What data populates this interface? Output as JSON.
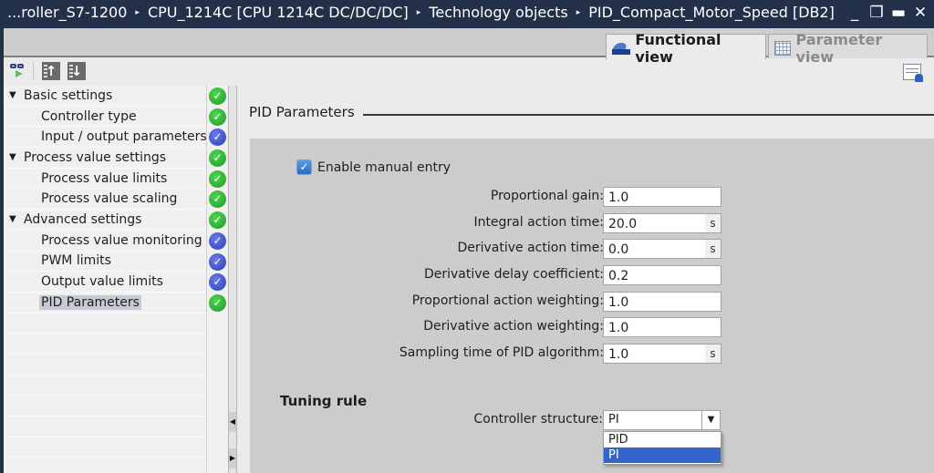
{
  "titlebar": {
    "breadcrumb": [
      "...roller_S7-1200",
      "CPU_1214C [CPU 1214C DC/DC/DC]",
      "Technology objects",
      "PID_Compact_Motor_Speed [DB2]"
    ],
    "separator": "▸",
    "controls": {
      "minimize": "_",
      "restore": "❐",
      "maximize": "▬",
      "close": "✕"
    }
  },
  "tabs": {
    "functional_view": "Functional view",
    "parameter_view": "Parameter view",
    "active": "Functional view"
  },
  "nav": {
    "items": [
      {
        "label": "Basic settings",
        "level": 0,
        "expanded": true,
        "status": "ok"
      },
      {
        "label": "Controller type",
        "level": 1,
        "status": "ok"
      },
      {
        "label": "Input / output parameters",
        "level": 1,
        "status": "info"
      },
      {
        "label": "Process value settings",
        "level": 0,
        "expanded": true,
        "status": "ok"
      },
      {
        "label": "Process value limits",
        "level": 1,
        "status": "ok"
      },
      {
        "label": "Process value scaling",
        "level": 1,
        "status": "ok"
      },
      {
        "label": "Advanced settings",
        "level": 0,
        "expanded": true,
        "status": "ok"
      },
      {
        "label": "Process value monitoring",
        "level": 1,
        "status": "info"
      },
      {
        "label": "PWM limits",
        "level": 1,
        "status": "info"
      },
      {
        "label": "Output value limits",
        "level": 1,
        "status": "info"
      },
      {
        "label": "PID Parameters",
        "level": 1,
        "status": "ok",
        "selected": true
      }
    ],
    "caret": "▼",
    "check": "✓"
  },
  "splitter": {
    "left_arrow": "◀",
    "right_arrow": "▶"
  },
  "content": {
    "section_title": "PID Parameters",
    "enable_manual_entry": {
      "label": "Enable manual entry",
      "checked": true,
      "check": "✓"
    },
    "fields": [
      {
        "label": "Proportional gain:",
        "value": "1.0",
        "unit": ""
      },
      {
        "label": "Integral action time:",
        "value": "20.0",
        "unit": "s"
      },
      {
        "label": "Derivative action time:",
        "value": "0.0",
        "unit": "s"
      },
      {
        "label": "Derivative delay coefficient:",
        "value": "0.2",
        "unit": ""
      },
      {
        "label": "Proportional action weighting:",
        "value": "1.0",
        "unit": ""
      },
      {
        "label": "Derivative action weighting:",
        "value": "1.0",
        "unit": ""
      },
      {
        "label": "Sampling time of PID algorithm:",
        "value": "1.0",
        "unit": "s"
      }
    ],
    "tuning_rule": {
      "title": "Tuning rule",
      "controller_structure_label": "Controller structure:",
      "controller_structure_value": "PI",
      "arrow": "▼",
      "options": [
        "PID",
        "PI"
      ],
      "highlighted_option": "PI"
    }
  },
  "colors": {
    "titlebar_bg": "#22304a",
    "status_ok": "#1e9a2a",
    "status_info": "#2c3fb8",
    "selection_blue": "#3366cc"
  }
}
